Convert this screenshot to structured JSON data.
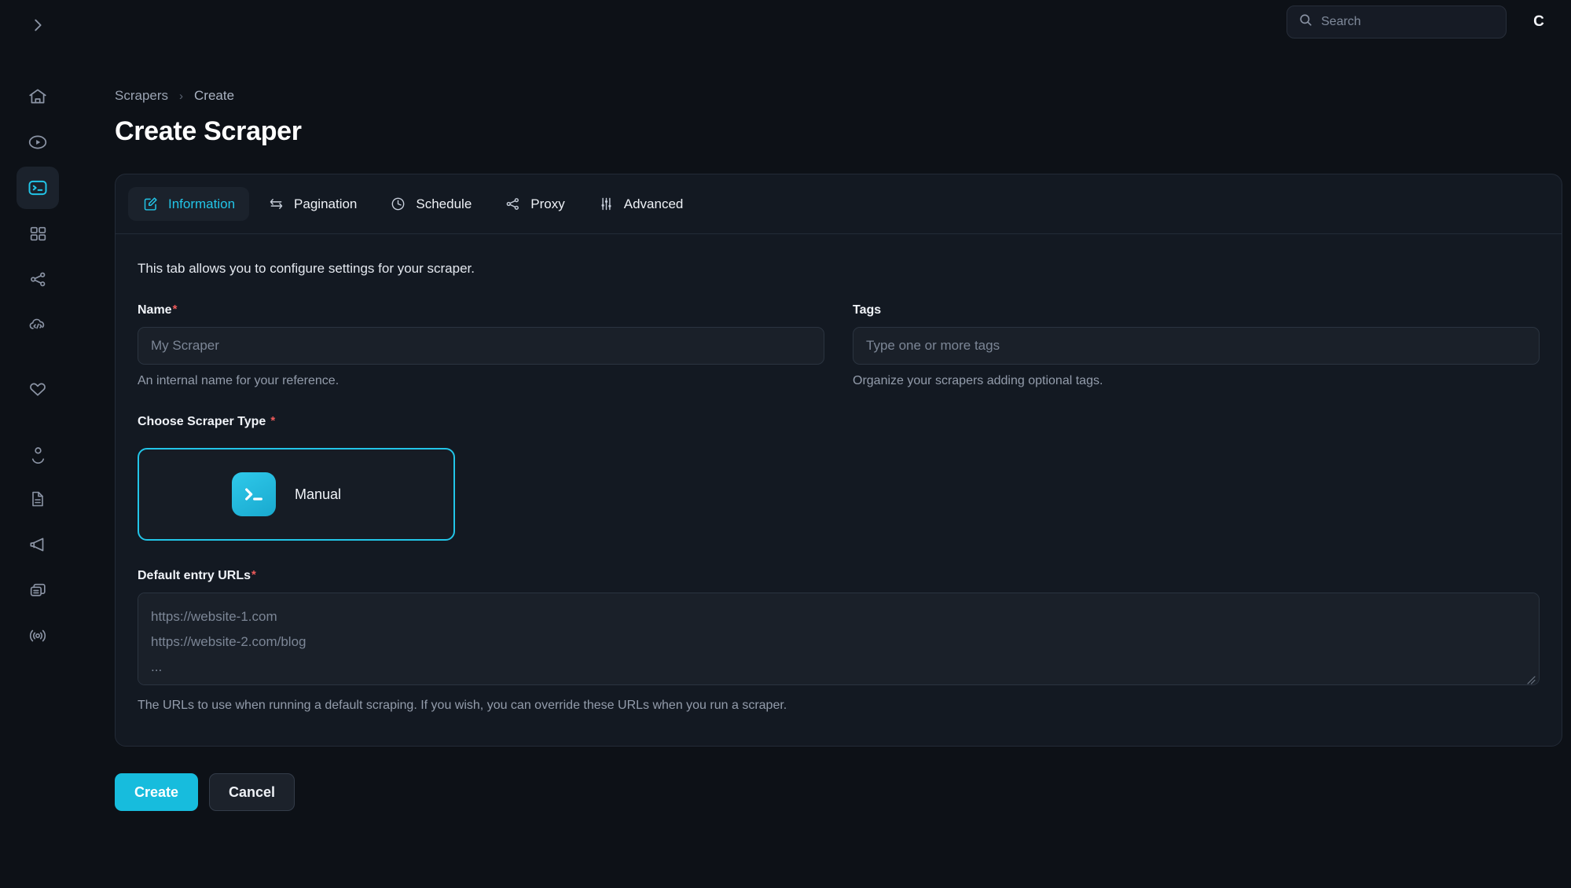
{
  "topbar": {
    "collapse_icon": "chevron-right-icon",
    "search": {
      "value": "",
      "placeholder": "Search",
      "icon": "search-icon"
    },
    "avatar_initial": "C"
  },
  "sidebar": {
    "items": [
      {
        "icon": "home-icon",
        "name": "home",
        "active": false
      },
      {
        "icon": "play-circle-icon",
        "name": "runs",
        "active": false
      },
      {
        "icon": "terminal-icon",
        "name": "scrapers",
        "active": true
      },
      {
        "icon": "grid-icon",
        "name": "datasets",
        "active": false
      },
      {
        "icon": "share-nodes-icon",
        "name": "integrations",
        "active": false
      },
      {
        "icon": "code-cloud-icon",
        "name": "api",
        "active": false
      },
      {
        "icon": "heart-icon",
        "name": "favorites",
        "active": false
      },
      {
        "icon": "user-icon",
        "name": "account",
        "active": false
      },
      {
        "icon": "document-icon",
        "name": "docs",
        "active": false
      },
      {
        "icon": "megaphone-icon",
        "name": "announcements",
        "active": false
      },
      {
        "icon": "copy-icon",
        "name": "templates",
        "active": false
      },
      {
        "icon": "broadcast-icon",
        "name": "status",
        "active": false
      }
    ]
  },
  "breadcrumb": {
    "parent": "Scrapers",
    "separator": "›",
    "current": "Create"
  },
  "page": {
    "title": "Create Scraper"
  },
  "tabs": [
    {
      "label": "Information",
      "icon": "edit-square-icon",
      "active": true
    },
    {
      "label": "Pagination",
      "icon": "exchange-arrows-icon",
      "active": false
    },
    {
      "label": "Schedule",
      "icon": "clock-icon",
      "active": false
    },
    {
      "label": "Proxy",
      "icon": "share-nodes-icon",
      "active": false
    },
    {
      "label": "Advanced",
      "icon": "sliders-icon",
      "active": false
    }
  ],
  "form": {
    "intro": "This tab allows you to configure settings for your scraper.",
    "name": {
      "label": "Name",
      "required_mark": "*",
      "value": "",
      "placeholder": "My Scraper",
      "hint": "An internal name for your reference."
    },
    "tags": {
      "label": "Tags",
      "value": "",
      "placeholder": "Type one or more tags",
      "hint": "Organize your scrapers adding optional tags."
    },
    "scraper_type": {
      "label": "Choose Scraper Type",
      "required_mark": "*",
      "options": [
        {
          "name": "Manual",
          "icon": "terminal-icon",
          "selected": true
        }
      ]
    },
    "entry_urls": {
      "label": "Default entry URLs",
      "required_mark": "*",
      "value": "",
      "placeholder": "https://website-1.com\nhttps://website-2.com/blog\n...",
      "hint": "The URLs to use when running a default scraping. If you wish, you can override these URLs when you run a scraper."
    }
  },
  "actions": {
    "create_label": "Create",
    "cancel_label": "Cancel"
  },
  "colors": {
    "accent": "#22c5e8",
    "primary_button": "#17bcdd",
    "required": "#ef5b5b",
    "page_bg": "#0d1117",
    "panel_bg": "#131922",
    "input_bg": "#1a2029",
    "border": "#232b37"
  }
}
